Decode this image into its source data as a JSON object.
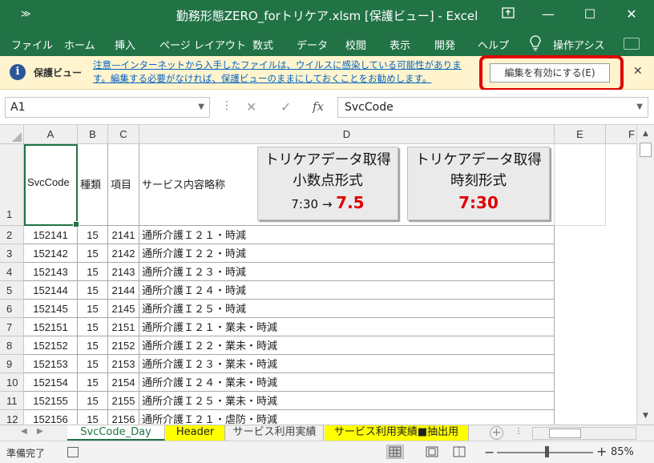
{
  "window": {
    "title": "勤務形態ZERO_forトリケア.xlsm [保護ビュー] - Excel",
    "quick_access": "≫"
  },
  "ribbon": {
    "tabs": [
      "ファイル",
      "ホーム",
      "挿入",
      "ページ レイアウト",
      "数式",
      "データ",
      "校閲",
      "表示",
      "開発",
      "ヘルプ",
      "操作アシス"
    ]
  },
  "protected_view": {
    "title": "保護ビュー",
    "message": "注意—インターネットから入手したファイルは、ウイルスに感染している可能性があります。編集する必要がなければ、保護ビューのままにしておくことをお勧めします。",
    "enable_button": "編集を有効にする(E)"
  },
  "formula_bar": {
    "name_box": "A1",
    "formula": "SvcCode"
  },
  "columns": [
    "A",
    "B",
    "C",
    "D",
    "E",
    "F"
  ],
  "header_row": {
    "row": "1",
    "svccode": "SvcCode",
    "type": "種類",
    "item": "項目",
    "name": "サービス内容略称"
  },
  "shapes": {
    "decimal": {
      "line1": "トリケアデータ取得",
      "line2": "小数点形式",
      "example_prefix": "7:30 → ",
      "example_value": "7.5"
    },
    "time": {
      "line1": "トリケアデータ取得",
      "line2": "時刻形式",
      "example_value": "7:30"
    }
  },
  "rows": [
    {
      "row": "2",
      "code": "152141",
      "type": "15",
      "item": "2141",
      "name": "通所介護Ｉ２１・時減"
    },
    {
      "row": "3",
      "code": "152142",
      "type": "15",
      "item": "2142",
      "name": "通所介護Ｉ２２・時減"
    },
    {
      "row": "4",
      "code": "152143",
      "type": "15",
      "item": "2143",
      "name": "通所介護Ｉ２３・時減"
    },
    {
      "row": "5",
      "code": "152144",
      "type": "15",
      "item": "2144",
      "name": "通所介護Ｉ２４・時減"
    },
    {
      "row": "6",
      "code": "152145",
      "type": "15",
      "item": "2145",
      "name": "通所介護Ｉ２５・時減"
    },
    {
      "row": "7",
      "code": "152151",
      "type": "15",
      "item": "2151",
      "name": "通所介護Ｉ２１・業未・時減"
    },
    {
      "row": "8",
      "code": "152152",
      "type": "15",
      "item": "2152",
      "name": "通所介護Ｉ２２・業未・時減"
    },
    {
      "row": "9",
      "code": "152153",
      "type": "15",
      "item": "2153",
      "name": "通所介護Ｉ２３・業未・時減"
    },
    {
      "row": "10",
      "code": "152154",
      "type": "15",
      "item": "2154",
      "name": "通所介護Ｉ２４・業未・時減"
    },
    {
      "row": "11",
      "code": "152155",
      "type": "15",
      "item": "2155",
      "name": "通所介護Ｉ２５・業未・時減"
    },
    {
      "row": "12",
      "code": "152156",
      "type": "15",
      "item": "2156",
      "name": "通所介護Ｉ２１・虐防・時減"
    }
  ],
  "sheet_tabs": [
    {
      "label": "SvcCode_Day",
      "style": "active"
    },
    {
      "label": "Header",
      "style": "yellow"
    },
    {
      "label": "サービス利用実績",
      "style": "plain"
    },
    {
      "label": "サービス利用実績■抽出用",
      "style": "yellow"
    }
  ],
  "status": {
    "ready": "準備完了",
    "zoom": "85%"
  }
}
